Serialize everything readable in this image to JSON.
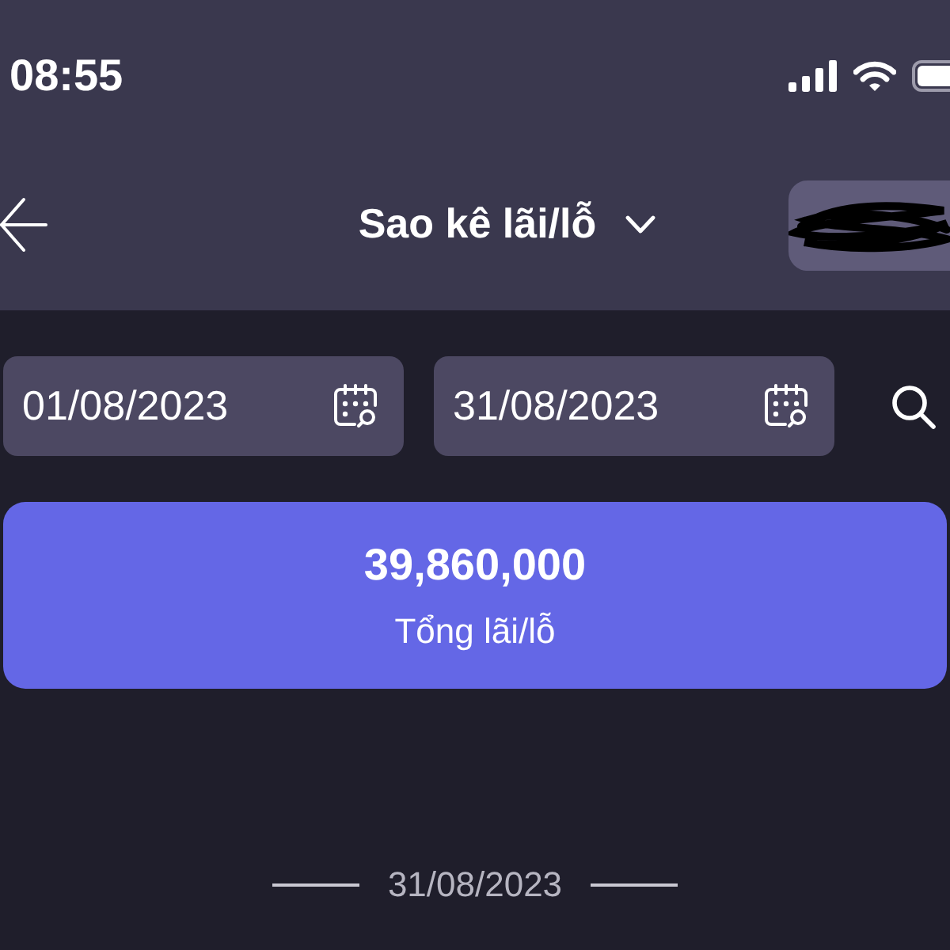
{
  "status_bar": {
    "time": "08:55"
  },
  "header": {
    "title": "Sao kê lãi/lỗ"
  },
  "filters": {
    "from_date": "01/08/2023",
    "to_date": "31/08/2023"
  },
  "summary": {
    "value": "39,860,000",
    "label": "Tổng lãi/lỗ"
  },
  "date_separator": {
    "date": "31/08/2023"
  }
}
